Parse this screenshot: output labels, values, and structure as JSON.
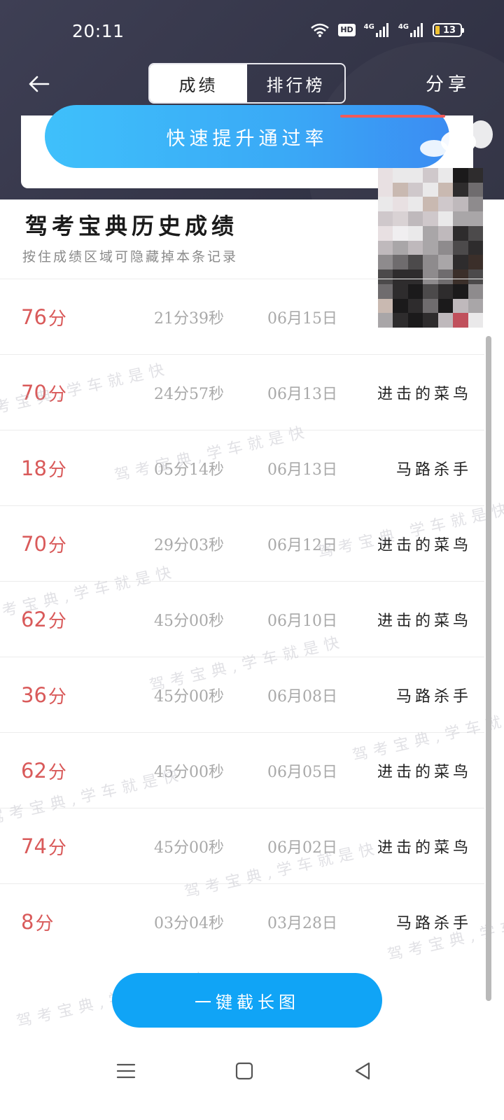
{
  "status_bar": {
    "time": "20:11",
    "hd_label": "HD",
    "network_1": "4G",
    "network_2": "4G",
    "battery": "13"
  },
  "header": {
    "tabs": [
      {
        "label": "成绩",
        "active": true
      },
      {
        "label": "排行榜",
        "active": false
      }
    ],
    "share_label": "分享"
  },
  "promo": {
    "button_label": "快速提升通过率"
  },
  "history": {
    "title": "驾考宝典历史成绩",
    "subtitle": "按住成绩区域可隐藏掉本条记录",
    "score_unit": "分",
    "records": [
      {
        "score": "76",
        "duration": "21分39秒",
        "date": "06月15日",
        "title": ""
      },
      {
        "score": "70",
        "duration": "24分57秒",
        "date": "06月13日",
        "title": "进击的菜鸟"
      },
      {
        "score": "18",
        "duration": "05分14秒",
        "date": "06月13日",
        "title": "马路杀手"
      },
      {
        "score": "70",
        "duration": "29分03秒",
        "date": "06月12日",
        "title": "进击的菜鸟"
      },
      {
        "score": "62",
        "duration": "45分00秒",
        "date": "06月10日",
        "title": "进击的菜鸟"
      },
      {
        "score": "36",
        "duration": "45分00秒",
        "date": "06月08日",
        "title": "马路杀手"
      },
      {
        "score": "62",
        "duration": "45分00秒",
        "date": "06月05日",
        "title": "进击的菜鸟"
      },
      {
        "score": "74",
        "duration": "45分00秒",
        "date": "06月02日",
        "title": "进击的菜鸟"
      },
      {
        "score": "8",
        "duration": "03分04秒",
        "date": "03月28日",
        "title": "马路杀手"
      }
    ]
  },
  "watermark_text": "驾考宝典,学车就是快",
  "long_screenshot_label": "一键截长图",
  "colors": {
    "header_bg": "#3a3b4f",
    "accent_blue": "#10a4f6",
    "score_red": "#d95a5a"
  },
  "icons": {
    "back": "arrow-left-icon",
    "nav_menu": "menu-icon",
    "nav_home": "square-icon",
    "nav_back": "triangle-back-icon"
  }
}
